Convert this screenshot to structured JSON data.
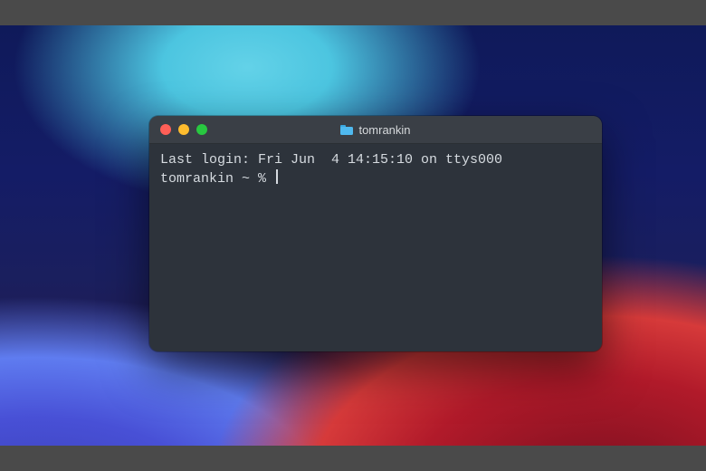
{
  "window": {
    "title": "tomrankin",
    "icon": "folder-icon"
  },
  "traffic_lights": {
    "close_color": "#ff5f57",
    "minimize_color": "#febc2e",
    "zoom_color": "#28c840"
  },
  "terminal": {
    "last_login_line": "Last login: Fri Jun  4 14:15:10 on ttys000",
    "prompt": "tomrankin ~ % ",
    "input_value": ""
  }
}
